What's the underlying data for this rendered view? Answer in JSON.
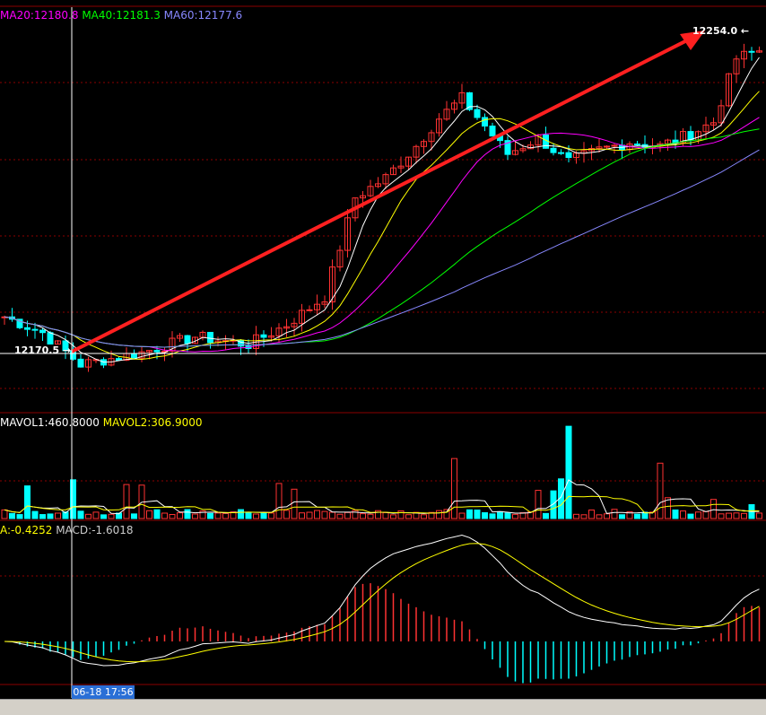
{
  "ma_legend": {
    "ma20": "MA20:12180.8",
    "ma40": "MA40:12181.3",
    "ma60": "MA60:12177.6"
  },
  "vol_legend": {
    "mavol1": "MAVOL1:460.8000",
    "mavol2": "MAVOL2:306.9000"
  },
  "macd_legend": {
    "dea": "A:-0.4252",
    "macd": "MACD:-1.6018"
  },
  "price_tags": {
    "high": "12254.0 ←",
    "low": "12170.5 →"
  },
  "cursor_time": "06-18 17:56",
  "colors": {
    "up": "#ff3232",
    "down": "#00ffff",
    "grid": "#8b0000",
    "ma5": "#ffffff",
    "ma10": "#ffff00",
    "ma20": "#ff00ff",
    "ma40": "#00ff00",
    "ma60": "#8888ff",
    "arrow": "#ff2020"
  },
  "chart_data": [
    {
      "type": "candlestick",
      "title": "",
      "price_range": [
        12162,
        12262
      ],
      "highest_marked": 12254.0,
      "lowest_marked": 12170.5,
      "num_bars": 100,
      "series": [
        {
          "name": "MA20",
          "last": 12180.8
        },
        {
          "name": "MA40",
          "last": 12181.3
        },
        {
          "name": "MA60",
          "last": 12177.6
        }
      ],
      "annotation": "red trend arrow from the low to the high"
    },
    {
      "type": "bar",
      "title": "",
      "series": [
        {
          "name": "MAVOL1",
          "last": 460.8
        },
        {
          "name": "MAVOL2",
          "last": 306.9
        }
      ]
    },
    {
      "type": "bar",
      "title": "",
      "series": [
        {
          "name": "DEA",
          "last": -0.4252
        },
        {
          "name": "MACD",
          "last": -1.6018
        }
      ]
    }
  ]
}
